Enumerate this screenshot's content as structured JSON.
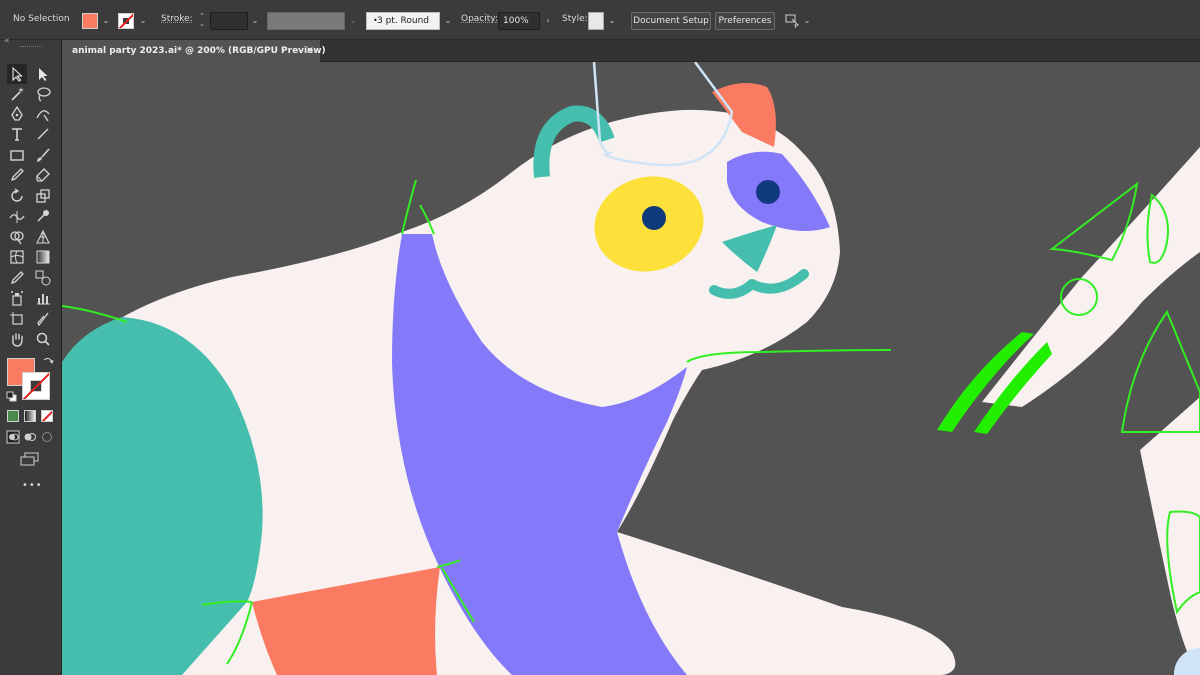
{
  "control_bar": {
    "selection_status": "No Selection",
    "stroke_label": "Stroke:",
    "stroke_weight": "",
    "brush_profile": "3 pt. Round",
    "opacity_label": "Opacity:",
    "opacity_value": "100%",
    "style_label": "Style:",
    "document_setup_label": "Document Setup",
    "preferences_label": "Preferences",
    "fill_color": "#fa7b62"
  },
  "document_tab": {
    "title": "animal party 2023.ai* @ 200% (RGB/GPU Preview)",
    "close_glyph": "×"
  },
  "tools": {
    "more_tools_glyph": "•••",
    "collapse_glyph": "«"
  },
  "colors": {
    "cream": "#f9f1f0",
    "purple": "#8479f9",
    "teal": "#46bead",
    "coral": "#fa7b62",
    "yellow": "#fde13a",
    "navy": "#0e3b7c",
    "guide_green": "#33ee22",
    "canvas_bg": "#535353"
  }
}
